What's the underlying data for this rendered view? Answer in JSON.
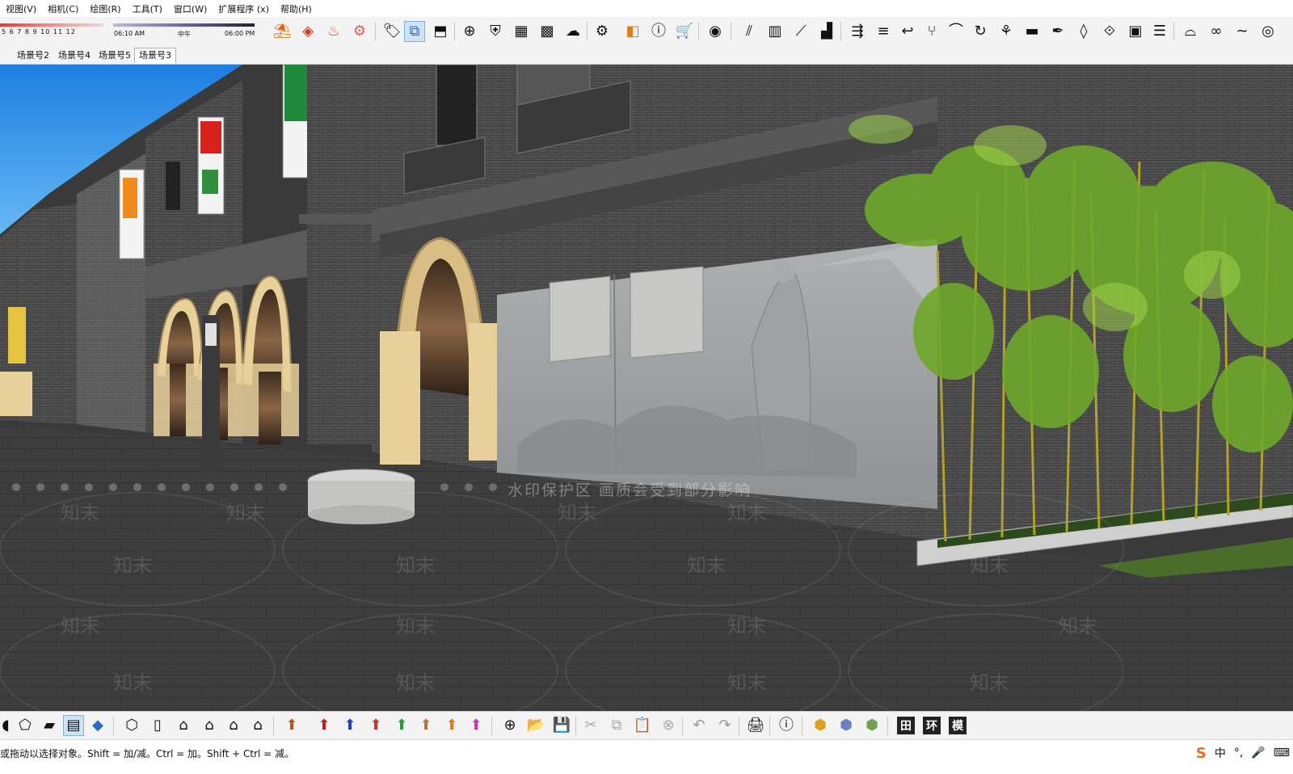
{
  "menu": [
    "视图(V)",
    "相机(C)",
    "绘图(R)",
    "工具(T)",
    "窗口(W)",
    "扩展程序 (x)",
    "帮助(H)"
  ],
  "shadow": {
    "months": "5  6  7  8  9  10  11  12",
    "time_start": "06:10 AM",
    "time_mid": "中午",
    "time_end": "06:00 PM"
  },
  "tabs": [
    "场景号2",
    "场景号4",
    "场景号5",
    "场景号3"
  ],
  "active_tab": "场景号3",
  "watermark": {
    "main": "水印保护区  画质会受到部分影响",
    "repeat": "知末"
  },
  "bottom_buttons_text": [
    "田",
    "环",
    "模"
  ],
  "status": "或拖动以选择对象。Shift = 加/减。Ctrl = 加。Shift + Ctrl = 减。",
  "ime": {
    "logo": "S",
    "lang": "中",
    "punct": "°,",
    "mic": "🎤",
    "keyboard": "⌨"
  },
  "colors": {
    "sky": "#2f8ee8",
    "brick": "#4a4a4a",
    "ground": "#3d3d3d",
    "column": "#e8d09a",
    "bamboo": "#6fa82a"
  }
}
